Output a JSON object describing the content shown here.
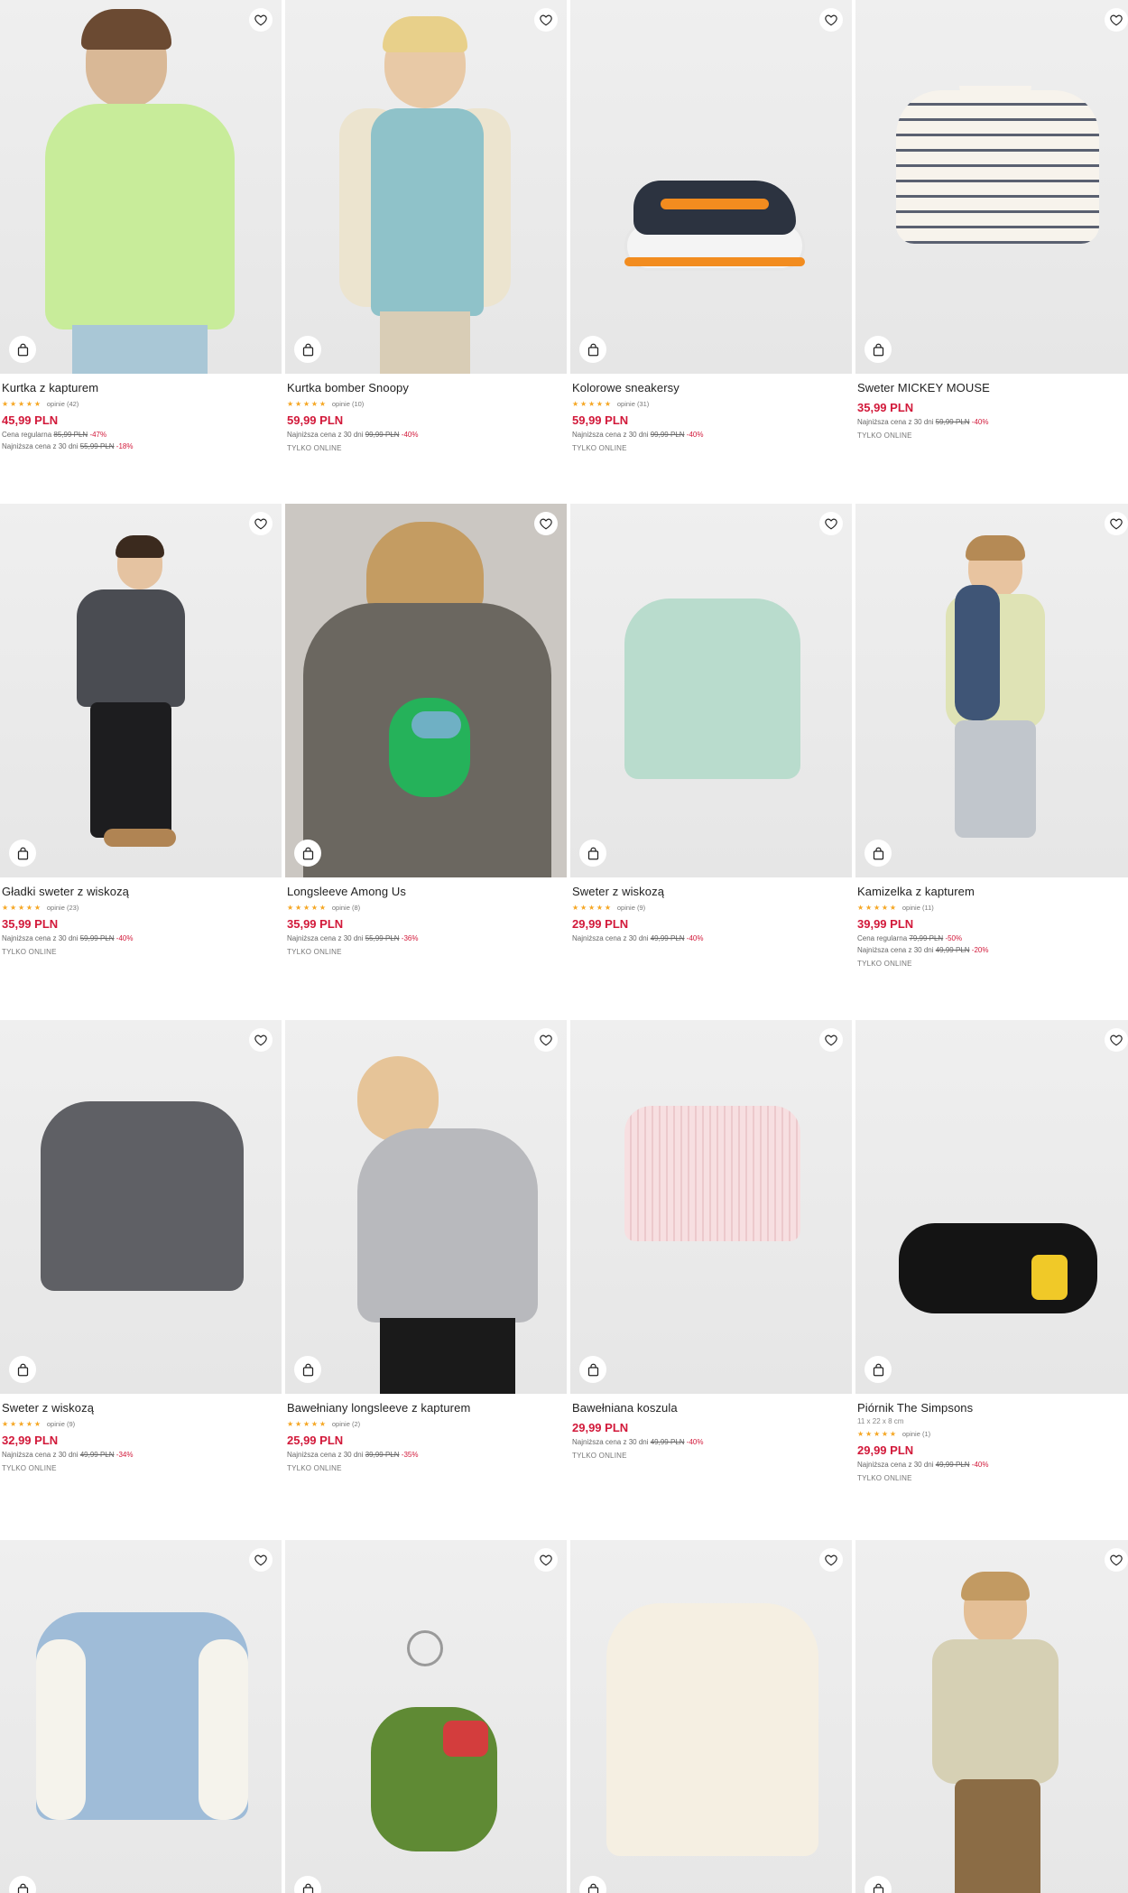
{
  "products": [
    {
      "title": "Kurtka z kapturem",
      "rating": 5,
      "reviews": "opinie (42)",
      "price": "45,99 PLN",
      "lines": [
        {
          "label": "Cena regularna",
          "old": "85,99 PLN",
          "disc": "-47%"
        },
        {
          "label": "Najniższa cena z 30 dni",
          "old": "55,99 PLN",
          "disc": "-18%"
        }
      ],
      "online": "",
      "dims": ""
    },
    {
      "title": "Kurtka bomber Snoopy",
      "rating": 5,
      "reviews": "opinie (10)",
      "price": "59,99 PLN",
      "lines": [
        {
          "label": "Najniższa cena z 30 dni",
          "old": "99,99 PLN",
          "disc": "-40%"
        }
      ],
      "online": "TYLKO ONLINE",
      "dims": ""
    },
    {
      "title": "Kolorowe sneakersy",
      "rating": 5,
      "reviews": "opinie (31)",
      "price": "59,99 PLN",
      "lines": [
        {
          "label": "Najniższa cena z 30 dni",
          "old": "99,99 PLN",
          "disc": "-40%"
        }
      ],
      "online": "TYLKO ONLINE",
      "dims": ""
    },
    {
      "title": "Sweter MICKEY MOUSE",
      "rating": 0,
      "reviews": "",
      "price": "35,99 PLN",
      "lines": [
        {
          "label": "Najniższa cena z 30 dni",
          "old": "59,99 PLN",
          "disc": "-40%"
        }
      ],
      "online": "TYLKO ONLINE",
      "dims": ""
    },
    {
      "title": "Gładki sweter z wiskozą",
      "rating": 5,
      "reviews": "opinie (23)",
      "price": "35,99 PLN",
      "lines": [
        {
          "label": "Najniższa cena z 30 dni",
          "old": "59,99 PLN",
          "disc": "-40%"
        }
      ],
      "online": "TYLKO ONLINE",
      "dims": ""
    },
    {
      "title": "Longsleeve Among Us",
      "rating": 5,
      "reviews": "opinie (8)",
      "price": "35,99 PLN",
      "lines": [
        {
          "label": "Najniższa cena z 30 dni",
          "old": "55,99 PLN",
          "disc": "-36%"
        }
      ],
      "online": "TYLKO ONLINE",
      "dims": ""
    },
    {
      "title": "Sweter z wiskozą",
      "rating": 5,
      "reviews": "opinie (9)",
      "price": "29,99 PLN",
      "lines": [
        {
          "label": "Najniższa cena z 30 dni",
          "old": "49,99 PLN",
          "disc": "-40%"
        }
      ],
      "online": "",
      "dims": ""
    },
    {
      "title": "Kamizelka z kapturem",
      "rating": 5,
      "reviews": "opinie (11)",
      "price": "39,99 PLN",
      "lines": [
        {
          "label": "Cena regularna",
          "old": "79,99 PLN",
          "disc": "-50%"
        },
        {
          "label": "Najniższa cena z 30 dni",
          "old": "49,99 PLN",
          "disc": "-20%"
        }
      ],
      "online": "TYLKO ONLINE",
      "dims": ""
    },
    {
      "title": "Sweter z wiskozą",
      "rating": 5,
      "reviews": "opinie (9)",
      "price": "32,99 PLN",
      "lines": [
        {
          "label": "Najniższa cena z 30 dni",
          "old": "49,99 PLN",
          "disc": "-34%"
        }
      ],
      "online": "TYLKO ONLINE",
      "dims": ""
    },
    {
      "title": "Bawełniany longsleeve z kapturem",
      "rating": 5,
      "reviews": "opinie (2)",
      "price": "25,99 PLN",
      "lines": [
        {
          "label": "Najniższa cena z 30 dni",
          "old": "39,99 PLN",
          "disc": "-35%"
        }
      ],
      "online": "TYLKO ONLINE",
      "dims": ""
    },
    {
      "title": "Bawełniana koszula",
      "rating": 0,
      "reviews": "",
      "price": "29,99 PLN",
      "lines": [
        {
          "label": "Najniższa cena z 30 dni",
          "old": "49,99 PLN",
          "disc": "-40%"
        }
      ],
      "online": "TYLKO ONLINE",
      "dims": ""
    },
    {
      "title": "Piórnik The Simpsons",
      "rating": 5,
      "reviews": "opinie (1)",
      "price": "29,99 PLN",
      "lines": [
        {
          "label": "Najniższa cena z 30 dni",
          "old": "49,99 PLN",
          "disc": "-40%"
        }
      ],
      "online": "TYLKO ONLINE",
      "dims": "11 x 22 x 8 cm"
    },
    {
      "title": "",
      "rating": 0,
      "reviews": "",
      "price": "",
      "lines": [],
      "online": "",
      "dims": ""
    },
    {
      "title": "",
      "rating": 0,
      "reviews": "",
      "price": "",
      "lines": [],
      "online": "",
      "dims": ""
    },
    {
      "title": "",
      "rating": 0,
      "reviews": "",
      "price": "",
      "lines": [],
      "online": "",
      "dims": ""
    },
    {
      "title": "",
      "rating": 0,
      "reviews": "",
      "price": "",
      "lines": [],
      "online": "",
      "dims": ""
    }
  ],
  "icons": {
    "favorite": "heart-icon",
    "cart": "shopping-bag-icon",
    "star": "star-icon"
  },
  "colors": {
    "price": "#d2193a",
    "star": "#f5a623"
  }
}
